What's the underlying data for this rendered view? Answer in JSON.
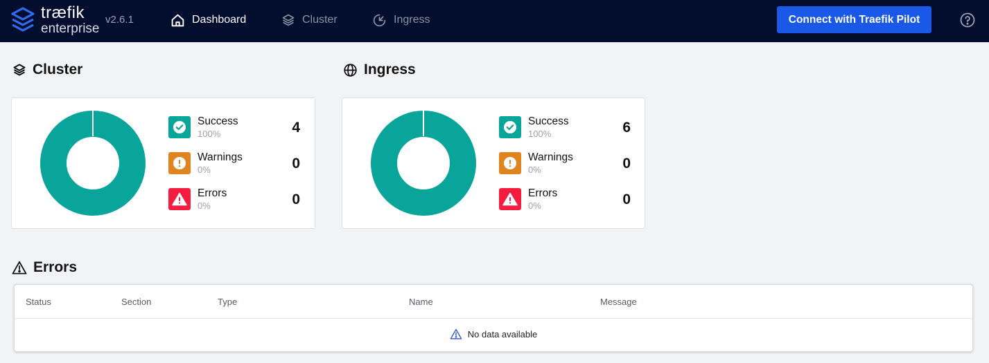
{
  "nav": {
    "brand_line1": "træfik",
    "brand_line2": "enterprise",
    "version": "v2.6.1",
    "items": [
      {
        "label": "Dashboard",
        "icon": "home-icon",
        "active": true
      },
      {
        "label": "Cluster",
        "icon": "layers-icon",
        "active": false
      },
      {
        "label": "Ingress",
        "icon": "gauge-icon",
        "active": false
      }
    ],
    "pilot_button": "Connect with Traefik Pilot",
    "help_icon": "help-circle-icon"
  },
  "cluster": {
    "title": "Cluster",
    "icon": "layers-icon",
    "stats": [
      {
        "label": "Success",
        "percent": "100%",
        "count": "4"
      },
      {
        "label": "Warnings",
        "percent": "0%",
        "count": "0"
      },
      {
        "label": "Errors",
        "percent": "0%",
        "count": "0"
      }
    ]
  },
  "ingress": {
    "title": "Ingress",
    "icon": "globe-icon",
    "stats": [
      {
        "label": "Success",
        "percent": "100%",
        "count": "6"
      },
      {
        "label": "Warnings",
        "percent": "0%",
        "count": "0"
      },
      {
        "label": "Errors",
        "percent": "0%",
        "count": "0"
      }
    ]
  },
  "errors": {
    "title": "Errors",
    "icon": "warning-triangle-icon",
    "columns": [
      "Status",
      "Section",
      "Type",
      "Name",
      "Message"
    ],
    "empty_text": "No data available"
  },
  "colors": {
    "navbar": "#030d2d",
    "accent_blue": "#1a58e8",
    "success": "#0aa59a",
    "warning": "#e08420",
    "error": "#f51c3f"
  }
}
